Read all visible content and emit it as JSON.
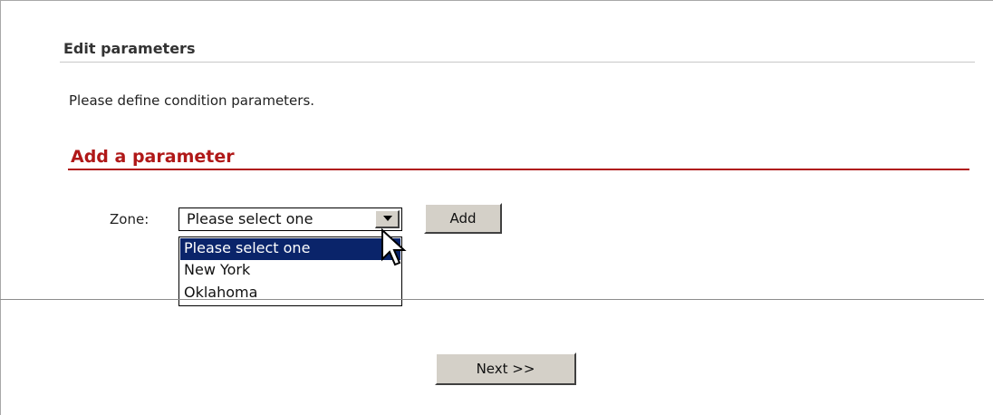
{
  "panel": {
    "title": "Edit parameters",
    "description": "Please define condition parameters."
  },
  "section": {
    "title": "Add a parameter",
    "accent_color": "#b01818"
  },
  "zone": {
    "label": "Zone:",
    "selected_value": "Please select one",
    "options": [
      "Please select one",
      "New York",
      "Oklahoma"
    ],
    "highlight_color": "#0a246a"
  },
  "buttons": {
    "add_label": "Add",
    "next_label": "Next >>"
  },
  "icons": {
    "dropdown_arrow": "triangle-down-icon",
    "cursor": "mouse-pointer-icon"
  }
}
